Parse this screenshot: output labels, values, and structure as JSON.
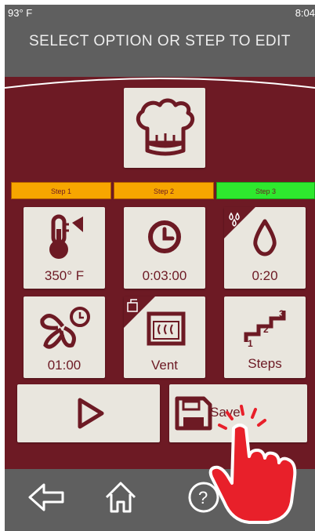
{
  "status": {
    "temperature": "93° F",
    "time": "8:04"
  },
  "header": {
    "title": "SELECT OPTION OR STEP TO EDIT"
  },
  "steps": [
    {
      "label": "Step 1",
      "color": "#f7a600"
    },
    {
      "label": "Step 2",
      "color": "#f7a600"
    },
    {
      "label": "Step 3",
      "color": "#2ee82e"
    }
  ],
  "tiles": {
    "temperature": {
      "value": "350° F",
      "icon": "thermometer-icon"
    },
    "time": {
      "value": "0:03:00",
      "icon": "clock-icon"
    },
    "humidity": {
      "value": "0:20",
      "icon": "droplet-icon"
    },
    "fan": {
      "value": "01:00",
      "icon": "fan-timer-icon"
    },
    "vent": {
      "value": "Vent",
      "icon": "vent-icon"
    },
    "steps": {
      "value": "Steps",
      "icon": "steps-icon"
    }
  },
  "actions": {
    "save_label": "Save",
    "start_icon": "play-icon",
    "save_icon": "floppy-disk-icon"
  },
  "colors": {
    "maroon": "#6d1a24",
    "tile": "#e9e6de",
    "frame": "#5f5f5f",
    "hand": "#e8202a"
  },
  "nav": [
    "back-arrow-icon",
    "home-icon",
    "help-icon"
  ]
}
